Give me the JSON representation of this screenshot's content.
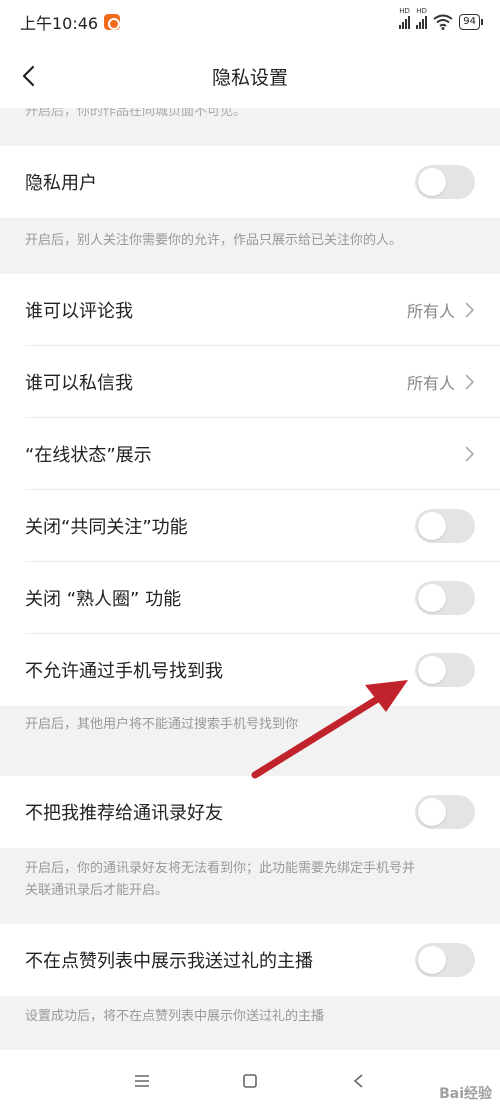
{
  "status_bar": {
    "time": "上午10:46",
    "battery": "94",
    "signal_label": "HD"
  },
  "header": {
    "title": "隐私设置",
    "back_icon": "chevron-left-icon"
  },
  "clipped_description": "开启后，你的作品在同城页面不可见。",
  "sections": [
    {
      "label": "隐私用户",
      "type": "toggle",
      "on": false,
      "description": "开启后，别人关注你需要你的允许，作品只展示给已关注你的人。"
    },
    {
      "label": "谁可以评论我",
      "type": "select",
      "value": "所有人"
    },
    {
      "label": "谁可以私信我",
      "type": "select",
      "value": "所有人"
    },
    {
      "label": "“在线状态”展示",
      "type": "link"
    },
    {
      "label": "关闭“共同关注”功能",
      "type": "toggle",
      "on": false
    },
    {
      "label": "关闭 “熟人圈” 功能",
      "type": "toggle",
      "on": false
    },
    {
      "label": "不允许通过手机号找到我",
      "type": "toggle",
      "on": false,
      "description": "开启后，其他用户将不能通过搜索手机号找到你"
    },
    {
      "label": "不把我推荐给通讯录好友",
      "type": "toggle",
      "on": false,
      "description_1": "开启后，你的通讯录好友将无法看到你；此功能需要先绑定手机号并",
      "description_2": "关联通讯录后才能开启。"
    },
    {
      "label": "不在点赞列表中展示我送过礼的主播",
      "type": "toggle",
      "on": false,
      "description": "设置成功后，将不在点赞列表中展示你送过礼的主播"
    }
  ],
  "bottom_nav": {
    "menu_icon": "menu-icon",
    "home_icon": "square-icon",
    "back_icon": "back-triangle-icon"
  },
  "annotation": {
    "color": "#c0232b"
  },
  "watermark": "Bai经验"
}
